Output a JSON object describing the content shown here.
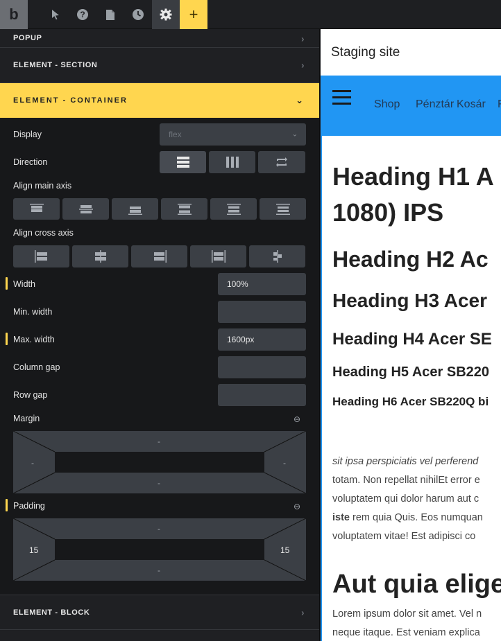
{
  "toolbar": {
    "logo": "b",
    "icons": [
      "pointer-icon",
      "help-icon",
      "page-icon",
      "history-icon",
      "settings-icon",
      "plus-icon"
    ],
    "plus_label": "+"
  },
  "panel": {
    "sections": {
      "popup": "POPUP",
      "section": "ELEMENT - SECTION",
      "container": "ELEMENT - CONTAINER",
      "block": "ELEMENT - BLOCK"
    },
    "display": {
      "label": "Display",
      "value": "flex"
    },
    "direction": {
      "label": "Direction"
    },
    "align_main": {
      "label": "Align main axis"
    },
    "align_cross": {
      "label": "Align cross axis"
    },
    "width": {
      "label": "Width",
      "value": "100%"
    },
    "min_width": {
      "label": "Min. width",
      "value": ""
    },
    "max_width": {
      "label": "Max. width",
      "value": "1600px"
    },
    "column_gap": {
      "label": "Column gap",
      "value": ""
    },
    "row_gap": {
      "label": "Row gap",
      "value": ""
    },
    "margin": {
      "label": "Margin",
      "top": "-",
      "right": "-",
      "bottom": "-",
      "left": "-"
    },
    "padding": {
      "label": "Padding",
      "top": "-",
      "right": "15",
      "bottom": "-",
      "left": "15"
    },
    "accent_color": "#ffd64f"
  },
  "preview": {
    "site_title": "Staging site",
    "nav_color": "#2196f3",
    "nav": [
      "Shop",
      "Pénztár",
      "Kosár",
      "F"
    ],
    "headings": {
      "h1_line1": "Heading H1 A",
      "h1_line2": "1080) IPS",
      "h2": "Heading H2 Ac",
      "h3": "Heading H3 Acer",
      "h4": "Heading H4 Acer SE",
      "h5": "Heading H5 Acer SB220",
      "h6": "Heading H6 Acer SB220Q bi"
    },
    "paragraph": {
      "line1": "sit ipsa perspiciatis vel perferend",
      "line2": "totam. Non repellat nihilEt error e",
      "line3": "voluptatem qui dolor harum aut c",
      "line4_bold": "iste",
      "line4_rest": " rem quia Quis. Eos numquan",
      "line5": "voluptatem vitae! Est adipisci co"
    },
    "big_heading": "Aut quia elige",
    "lorem": {
      "line1": "Lorem ipsum dolor sit amet. Vel n",
      "line2": "neque itaque. Est veniam explica"
    }
  }
}
